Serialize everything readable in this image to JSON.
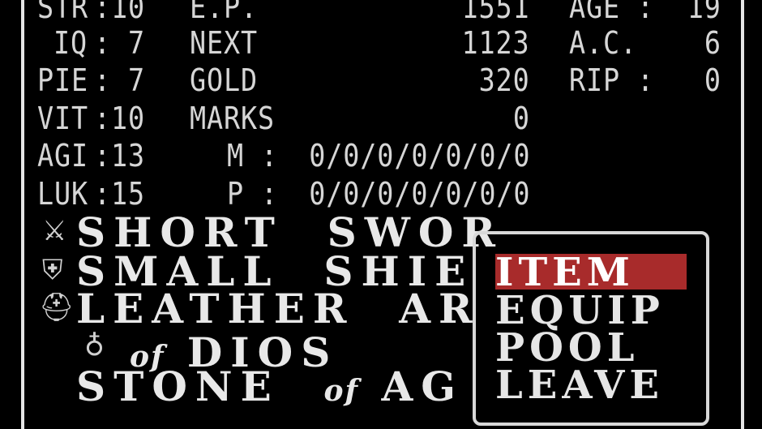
{
  "stats": {
    "str": {
      "label": "STR",
      "value": ":10"
    },
    "iq": {
      "label": "IQ",
      "value": ": 7"
    },
    "pie": {
      "label": "PIE",
      "value": ": 7"
    },
    "vit": {
      "label": "VIT",
      "value": ":10"
    },
    "agi": {
      "label": "AGI",
      "value": ":13"
    },
    "luk": {
      "label": "LUK",
      "value": ":15"
    }
  },
  "info": {
    "ep": {
      "label": "E.P.",
      "value": "1551"
    },
    "next": {
      "label": "NEXT",
      "value": "1123"
    },
    "gold": {
      "label": "GOLD",
      "value": "320"
    },
    "marks": {
      "label": "MARKS",
      "value": "0"
    },
    "m_spells": {
      "label": "M :",
      "value": "0/0/0/0/0/0/0"
    },
    "p_spells": {
      "label": "P :",
      "value": "0/0/0/0/0/0/0"
    }
  },
  "status": {
    "age": {
      "label": "AGE :",
      "value": "19"
    },
    "ac": {
      "label": "A.C.",
      "value": "6"
    },
    "rip": {
      "label": "RIP :",
      "value": "0"
    }
  },
  "equipment": [
    {
      "icon": "sword-icon",
      "name": "SHORT  SWOR"
    },
    {
      "icon": "shield-icon",
      "name": "SMALL  SHIE"
    },
    {
      "icon": "helmet-icon",
      "name": "LEATHER  AR"
    },
    {
      "icon": "amulet-icon",
      "of": "of",
      "name": "DIOS"
    },
    {
      "name": "STONE",
      "of": "of",
      "suffix": "AG"
    }
  ],
  "menu": {
    "items": [
      "ITEM",
      "EQUIP",
      "POOL",
      "LEAVE"
    ],
    "selected": "ITEM"
  },
  "colors": {
    "selection": "#a82b2b",
    "text": "#d6d6d6",
    "background": "#000000"
  }
}
